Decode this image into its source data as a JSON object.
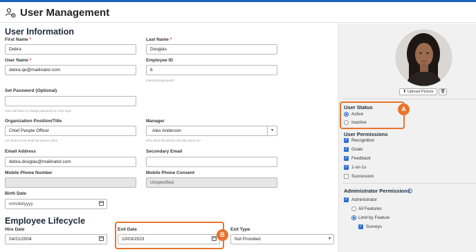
{
  "header": {
    "title": "User Management",
    "icon": "users-gear-icon"
  },
  "user_info": {
    "section_title": "User Information",
    "first_name": {
      "label": "First Name",
      "required": "*",
      "value": "Debra"
    },
    "last_name": {
      "label": "Last Name",
      "required": "*",
      "value": "Douglas"
    },
    "user_name": {
      "label": "User Name",
      "required": "*",
      "value": "debra.qe@mailinator.com"
    },
    "employee_id": {
      "label": "Employee ID",
      "value": "6",
      "hint": "Internal EmployeeID"
    },
    "password": {
      "label": "Set Password (Optional)",
      "value": "",
      "hint": "User will have to change password on next login"
    },
    "position": {
      "label": "Organization Position/Title",
      "value": "Chief People Officer",
      "hint": "Let others know what the person does"
    },
    "manager": {
      "label": "Manager",
      "value": "Alex Anderson",
      "hint": "Who does the person directly report to?"
    },
    "email": {
      "label": "Email Address",
      "value": "debra.douglas@mailinator.com"
    },
    "secondary_email": {
      "label": "Secondary Email",
      "value": ""
    },
    "mobile": {
      "label": "Mobile Phone Number",
      "value": ""
    },
    "mobile_consent": {
      "label": "Mobile Phone Consent",
      "value": "Unspecified"
    },
    "birth_date": {
      "label": "Birth Date",
      "placeholder": "mm/dd/yyyy"
    }
  },
  "lifecycle": {
    "section_title": "Employee Lifecycle",
    "hire_date": {
      "label": "Hire Date",
      "value": "04/21/2004"
    },
    "exit_date": {
      "label": "Exit Date",
      "value": "10/03/2023"
    },
    "exit_type": {
      "label": "Exit Type",
      "value": "Not Provided"
    }
  },
  "sidebar": {
    "upload_label": "Upload Picture",
    "status": {
      "title": "User Status",
      "options": [
        "Active",
        "Inactive"
      ],
      "selected": "Active"
    },
    "permissions": {
      "title": "User Permissions",
      "items": [
        {
          "label": "Recognition",
          "checked": true
        },
        {
          "label": "Goals",
          "checked": true
        },
        {
          "label": "Feedback",
          "checked": true
        },
        {
          "label": "1-on-1s",
          "checked": true
        },
        {
          "label": "Succession",
          "checked": false
        }
      ]
    },
    "admin": {
      "title": "Administrator Permissions",
      "administrator": "Administrator",
      "all_features": "All Features",
      "limit_by_feature": "Limit by Feature",
      "surveys": "Surveys"
    }
  },
  "callouts": {
    "a": "A",
    "b": "B"
  },
  "colors": {
    "accent": "#1f5fbf",
    "highlight": "#e8742c"
  }
}
